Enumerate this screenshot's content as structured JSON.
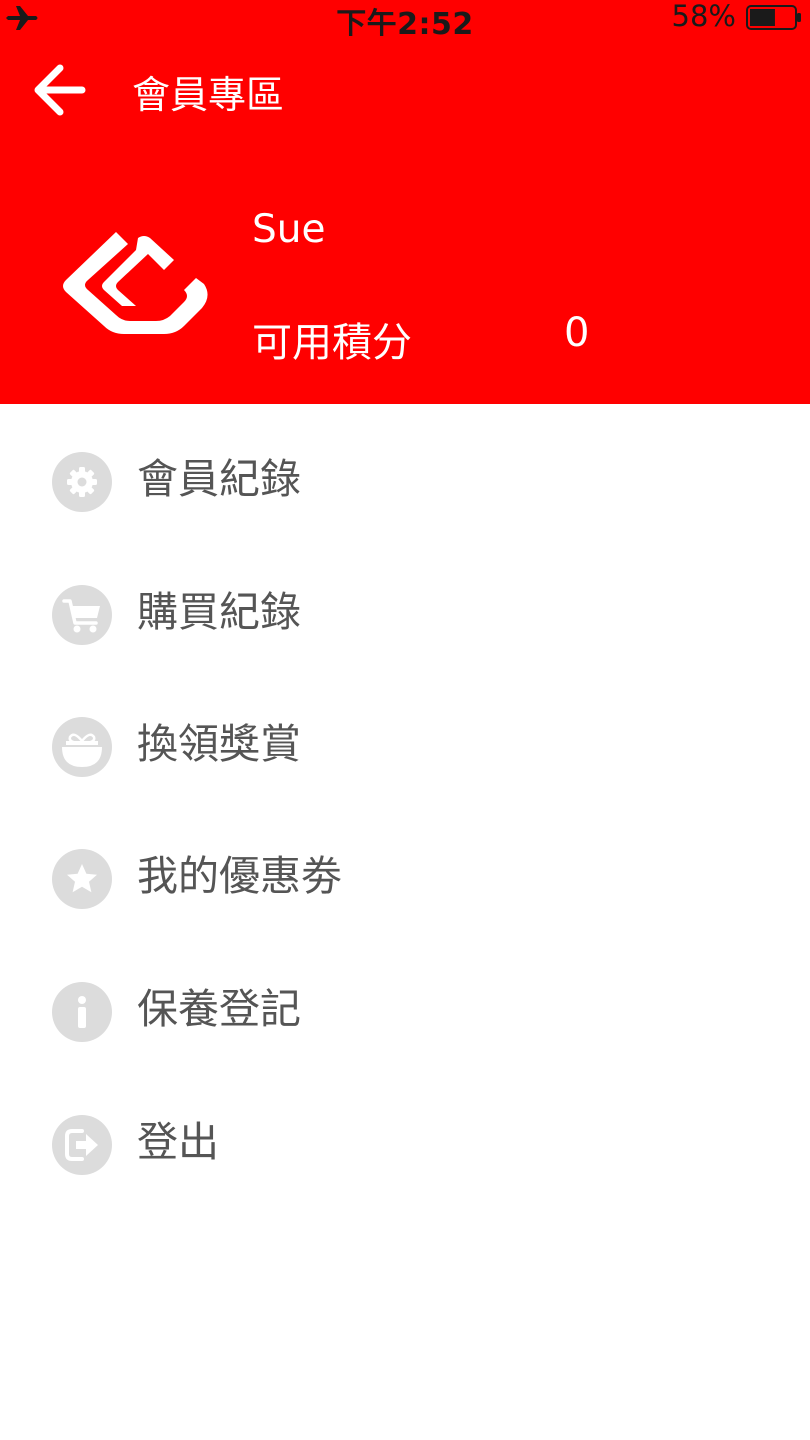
{
  "status_bar": {
    "time": "下午2:52",
    "battery_percent": "58%",
    "battery_level": 0.58,
    "airplane_icon": "airplane-icon"
  },
  "header": {
    "title": "會員專區",
    "back_icon": "back-arrow-icon",
    "logo_icon": "brand-logo",
    "user_name": "Sue",
    "points_label": "可用積分",
    "points_value": "0"
  },
  "menu": {
    "items": [
      {
        "label": "會員紀錄",
        "icon": "gear-icon"
      },
      {
        "label": "購買紀錄",
        "icon": "cart-icon"
      },
      {
        "label": "換領獎賞",
        "icon": "gift-icon"
      },
      {
        "label": "我的優惠劵",
        "icon": "star-icon"
      },
      {
        "label": "保養登記",
        "icon": "info-icon"
      },
      {
        "label": "登出",
        "icon": "logout-icon"
      }
    ]
  },
  "colors": {
    "brand_red": "#ff0000",
    "menu_text": "#555555",
    "icon_bg": "#dcdcdc",
    "icon_fg": "#ffffff"
  }
}
